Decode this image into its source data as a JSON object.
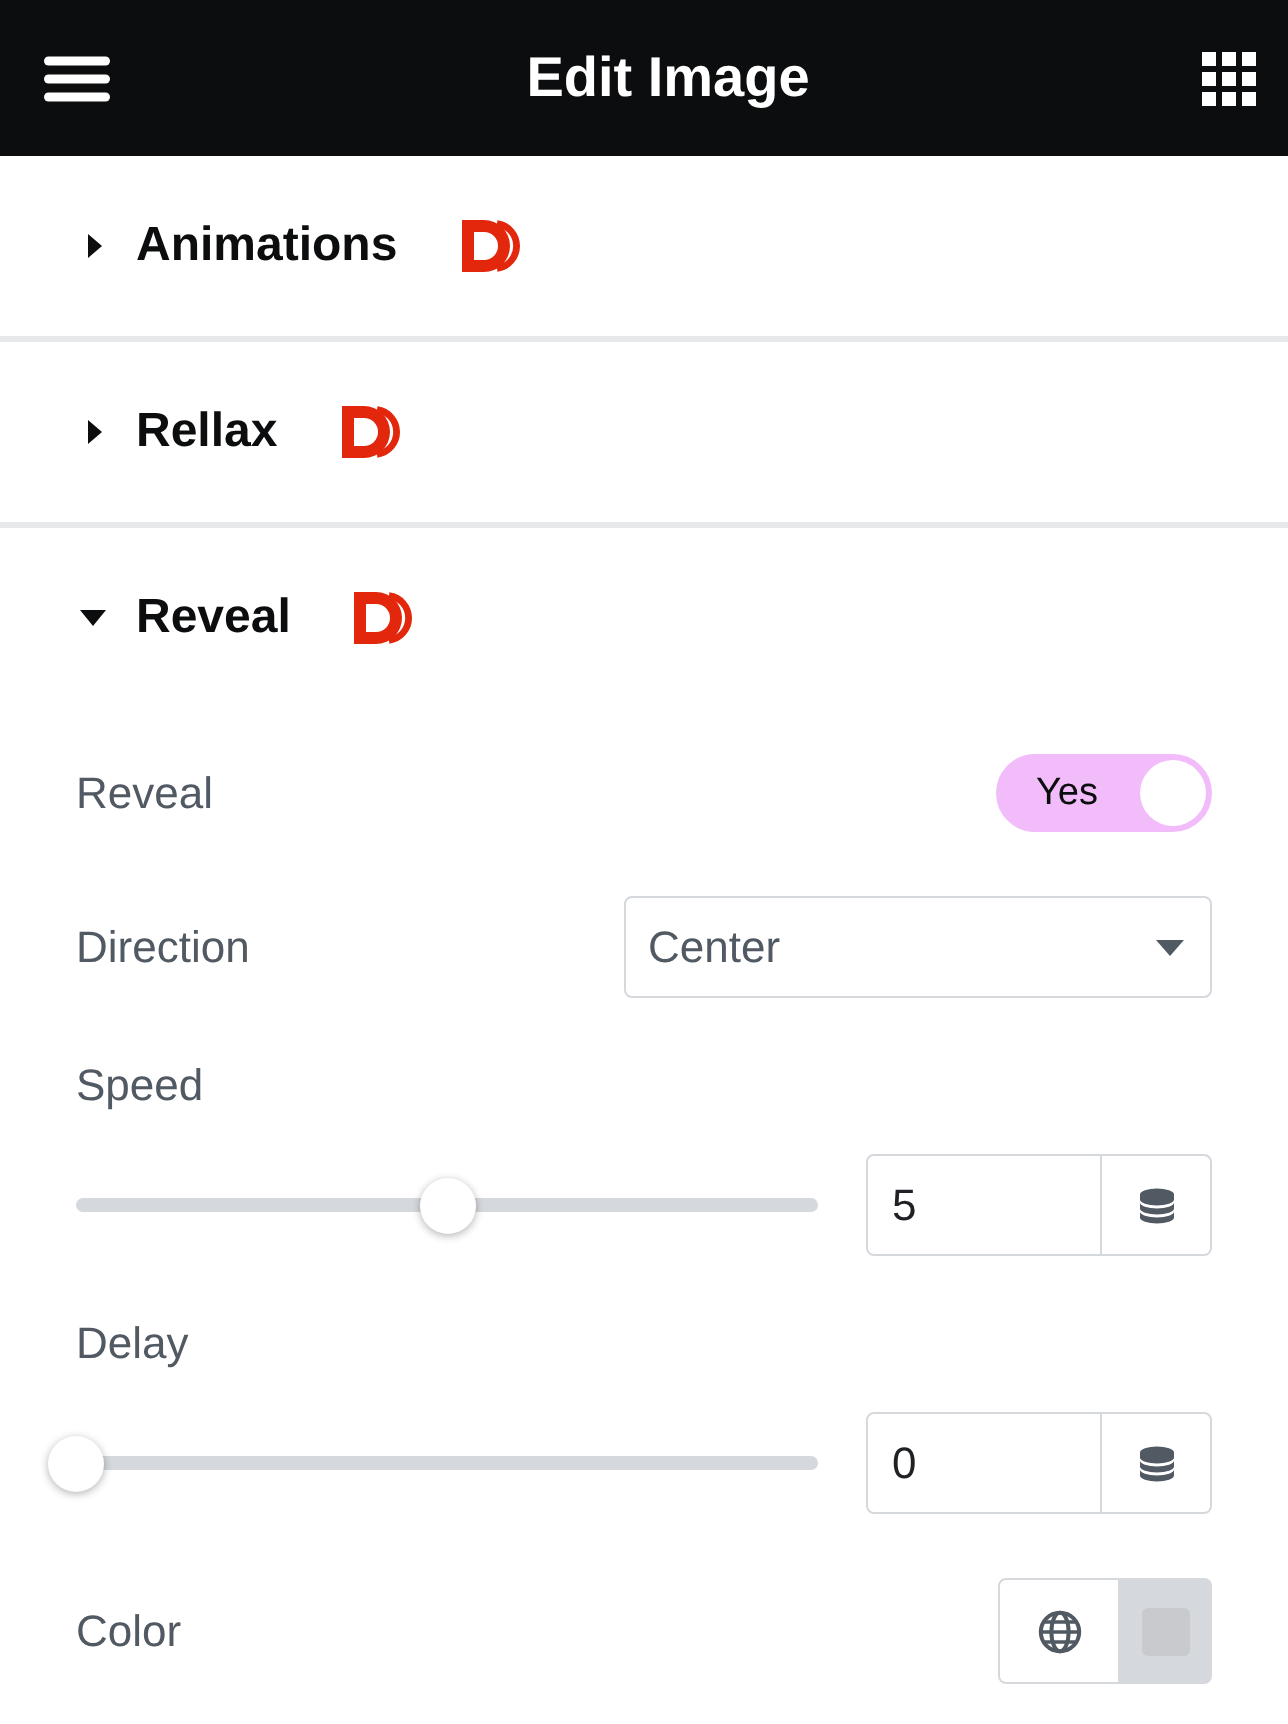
{
  "header": {
    "title": "Edit Image"
  },
  "sections": [
    {
      "title": "Animations",
      "expanded": false
    },
    {
      "title": "Rellax",
      "expanded": false
    },
    {
      "title": "Reveal",
      "expanded": true,
      "controls": [
        {
          "kind": "switch",
          "label": "Reveal",
          "on": true,
          "switch_text": "Yes"
        },
        {
          "kind": "select",
          "label": "Direction",
          "value": "Center"
        },
        {
          "kind": "slider",
          "label": "Speed",
          "level": 0.5,
          "value": "5"
        },
        {
          "kind": "slider",
          "label": "Delay",
          "level": 0,
          "value": "0"
        },
        {
          "kind": "color",
          "label": "Color"
        }
      ]
    }
  ]
}
